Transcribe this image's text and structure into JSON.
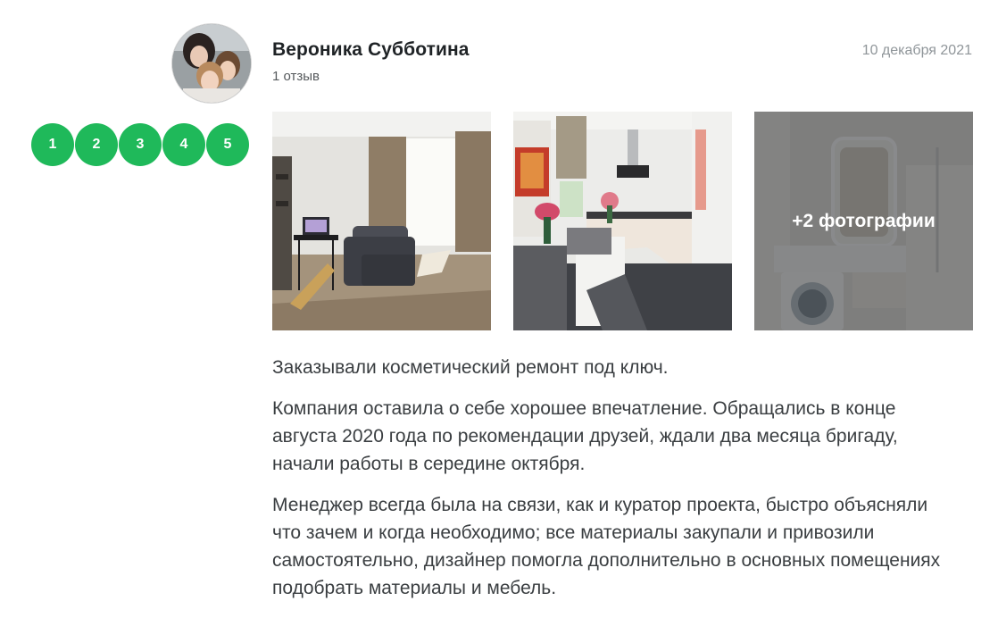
{
  "author": {
    "name": "Вероника Субботина",
    "reviews_count": "1 отзыв",
    "avatar": "avatar-photo"
  },
  "review": {
    "date": "10 декабря 2021",
    "rating": {
      "options": [
        "1",
        "2",
        "3",
        "4",
        "5"
      ],
      "color": "#1fb95a"
    },
    "photos": [
      {
        "subject": "living-room"
      },
      {
        "subject": "kitchen"
      },
      {
        "subject": "bathroom",
        "overlay_label": "+2 фотографии"
      }
    ],
    "paragraphs": [
      "Заказывали косметический ремонт под ключ.",
      "Компания оставила о себе хорошее впечатление. Обращались в конце августа 2020 года по рекомендации друзей, ждали два месяца бригаду, начали работы в середине октября.",
      "Менеджер всегда была на связи, как и куратор проекта, быстро объясняли что зачем и когда необходимо; все материалы закупали и привозили самостоятельно, дизайнер помогла дополнительно в основных помещениях подобрать материалы и мебель."
    ]
  }
}
